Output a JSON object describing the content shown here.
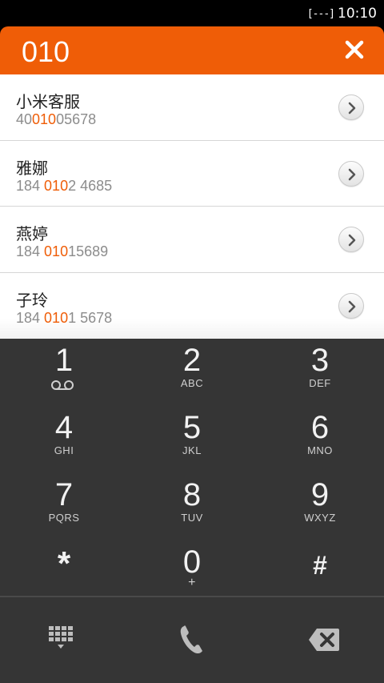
{
  "status_bar": {
    "signal": "[---]",
    "time": "10:10"
  },
  "search": {
    "query": "010"
  },
  "results": [
    {
      "name": "小米客服",
      "number_pre": "40",
      "number_match": "010",
      "number_post": "05678"
    },
    {
      "name": "雅娜",
      "number_pre": "184 ",
      "number_match": "010",
      "number_post": "2 4685"
    },
    {
      "name": "燕婷",
      "number_pre": "184 ",
      "number_match": "010",
      "number_post": "15689"
    },
    {
      "name": "子玲",
      "number_pre": "184 ",
      "number_match": "010",
      "number_post": "1 5678"
    }
  ],
  "keypad": {
    "k1": {
      "digit": "1",
      "letters": ""
    },
    "k2": {
      "digit": "2",
      "letters": "ABC"
    },
    "k3": {
      "digit": "3",
      "letters": "DEF"
    },
    "k4": {
      "digit": "4",
      "letters": "GHI"
    },
    "k5": {
      "digit": "5",
      "letters": "JKL"
    },
    "k6": {
      "digit": "6",
      "letters": "MNO"
    },
    "k7": {
      "digit": "7",
      "letters": "PQRS"
    },
    "k8": {
      "digit": "8",
      "letters": "TUV"
    },
    "k9": {
      "digit": "9",
      "letters": "WXYZ"
    },
    "kstar": {
      "digit": "*",
      "letters": ""
    },
    "k0": {
      "digit": "0",
      "letters": "+"
    },
    "khash": {
      "digit": "#",
      "letters": ""
    }
  },
  "icons": {
    "voicemail": "voicemail-icon",
    "close": "close-icon",
    "detail": "chevron-right-icon",
    "dialpad": "dialpad-icon",
    "call": "phone-icon",
    "delete": "backspace-icon"
  },
  "colors": {
    "accent": "#ef5d07",
    "keypad_bg": "#353535"
  }
}
